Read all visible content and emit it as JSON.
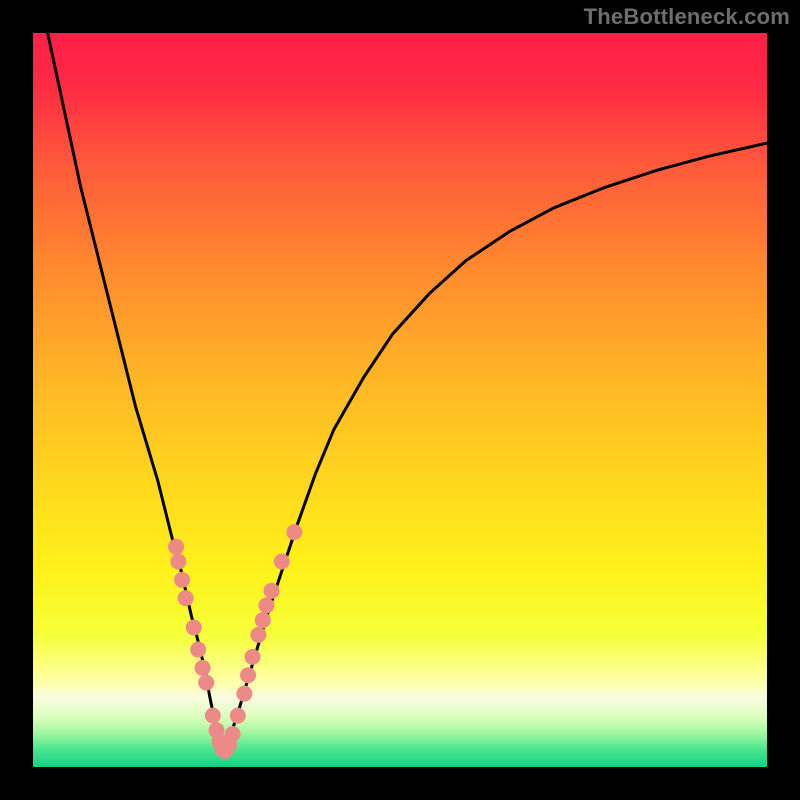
{
  "watermark": {
    "text": "TheBottleneck.com"
  },
  "chart_data": {
    "type": "line",
    "title": "",
    "xlabel": "",
    "ylabel": "",
    "xlim": [
      0,
      100
    ],
    "ylim": [
      0,
      100
    ],
    "grid": false,
    "legend": false,
    "background": {
      "kind": "vertical-gradient",
      "stops": [
        {
          "pos": 0.0,
          "color": "#ff1f47"
        },
        {
          "pos": 0.07,
          "color": "#ff2a45"
        },
        {
          "pos": 0.18,
          "color": "#ff5a3a"
        },
        {
          "pos": 0.32,
          "color": "#ff8a2f"
        },
        {
          "pos": 0.46,
          "color": "#ffb326"
        },
        {
          "pos": 0.6,
          "color": "#ffd51f"
        },
        {
          "pos": 0.73,
          "color": "#fff21a"
        },
        {
          "pos": 0.82,
          "color": "#f6ff3a"
        },
        {
          "pos": 0.885,
          "color": "#ffffa8"
        },
        {
          "pos": 0.905,
          "color": "#fafce0"
        },
        {
          "pos": 0.935,
          "color": "#d6ffb8"
        },
        {
          "pos": 0.955,
          "color": "#9cf7a0"
        },
        {
          "pos": 0.975,
          "color": "#4fe690"
        },
        {
          "pos": 1.0,
          "color": "#14d183"
        }
      ]
    },
    "series": [
      {
        "name": "left-arm",
        "color": "#000000",
        "x": [
          2.0,
          3.5,
          5.0,
          6.5,
          8.0,
          9.5,
          11.0,
          12.5,
          14.0,
          15.5,
          17.0,
          18.0,
          19.0,
          20.0,
          20.8,
          21.6,
          22.4,
          23.0,
          23.6,
          24.0,
          24.4,
          24.8,
          25.2,
          25.6,
          25.9
        ],
        "y": [
          100.0,
          93.0,
          86.0,
          79.0,
          73.0,
          67.0,
          61.0,
          55.0,
          49.0,
          44.0,
          39.0,
          35.0,
          31.0,
          27.5,
          24.0,
          20.5,
          17.5,
          15.0,
          12.5,
          10.0,
          8.0,
          6.0,
          4.5,
          3.0,
          2.0
        ]
      },
      {
        "name": "right-arm",
        "color": "#000000",
        "x": [
          26.0,
          26.8,
          27.8,
          29.0,
          30.5,
          32.0,
          34.0,
          36.0,
          38.5,
          41.0,
          45.0,
          49.0,
          54.0,
          59.0,
          65.0,
          71.0,
          78.0,
          85.0,
          92.0,
          100.0
        ],
        "y": [
          2.0,
          4.0,
          7.0,
          11.0,
          16.0,
          21.0,
          27.0,
          33.0,
          40.0,
          46.0,
          53.0,
          59.0,
          64.5,
          69.0,
          73.0,
          76.2,
          79.0,
          81.3,
          83.2,
          85.0
        ]
      }
    ],
    "scatter_clusters": [
      {
        "name": "cluster-dots",
        "color": "#ed8a87",
        "radius": 8,
        "points": [
          {
            "x": 19.5,
            "y": 30.0
          },
          {
            "x": 19.8,
            "y": 28.0
          },
          {
            "x": 20.3,
            "y": 25.5
          },
          {
            "x": 20.8,
            "y": 23.0
          },
          {
            "x": 21.9,
            "y": 19.0
          },
          {
            "x": 22.5,
            "y": 16.0
          },
          {
            "x": 23.1,
            "y": 13.5
          },
          {
            "x": 23.6,
            "y": 11.5
          },
          {
            "x": 24.5,
            "y": 7.0
          },
          {
            "x": 25.0,
            "y": 5.0
          },
          {
            "x": 25.4,
            "y": 3.5
          },
          {
            "x": 25.8,
            "y": 2.4
          },
          {
            "x": 26.2,
            "y": 2.2
          },
          {
            "x": 26.7,
            "y": 3.0
          },
          {
            "x": 27.2,
            "y": 4.5
          },
          {
            "x": 27.9,
            "y": 7.0
          },
          {
            "x": 28.8,
            "y": 10.0
          },
          {
            "x": 29.3,
            "y": 12.5
          },
          {
            "x": 29.9,
            "y": 15.0
          },
          {
            "x": 30.7,
            "y": 18.0
          },
          {
            "x": 31.3,
            "y": 20.0
          },
          {
            "x": 31.8,
            "y": 22.0
          },
          {
            "x": 32.5,
            "y": 24.0
          },
          {
            "x": 33.9,
            "y": 28.0
          },
          {
            "x": 35.6,
            "y": 32.0
          }
        ]
      }
    ]
  }
}
